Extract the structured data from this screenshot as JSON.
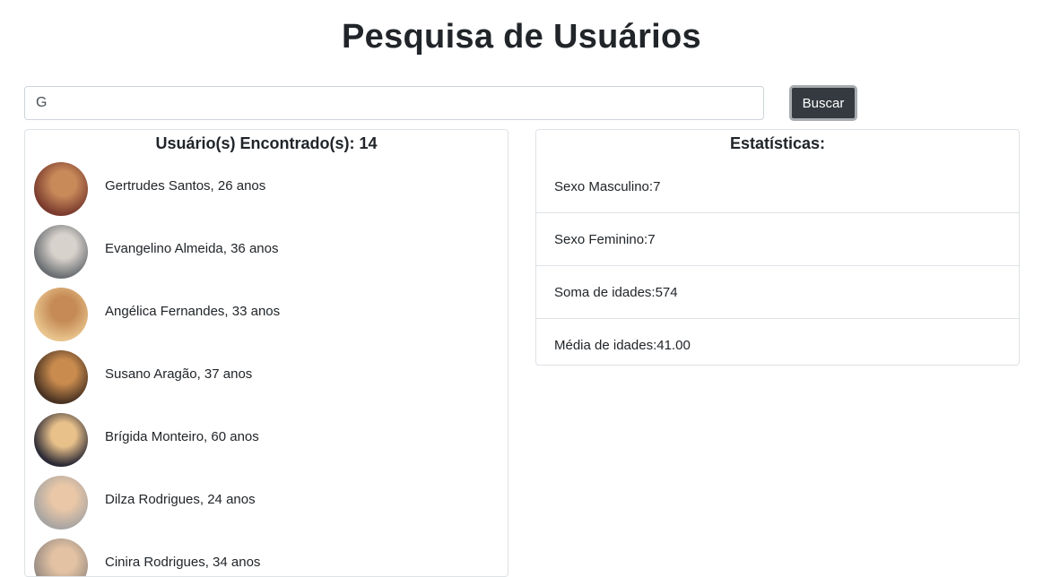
{
  "page": {
    "title": "Pesquisa de Usuários"
  },
  "search": {
    "value": "G",
    "button_label": "Buscar"
  },
  "users": {
    "header": "Usuário(s) Encontrado(s): 14",
    "items": [
      {
        "text": "Gertrudes Santos, 26 anos"
      },
      {
        "text": "Evangelino Almeida, 36 anos"
      },
      {
        "text": "Angélica Fernandes, 33 anos"
      },
      {
        "text": "Susano Aragão, 37 anos"
      },
      {
        "text": "Brígida Monteiro, 60 anos"
      },
      {
        "text": "Dilza Rodrigues, 24 anos"
      },
      {
        "text": "Cinira Rodrigues, 34 anos"
      }
    ]
  },
  "stats": {
    "header": "Estatísticas:",
    "items": [
      {
        "label": "Sexo Masculino:",
        "value": "7"
      },
      {
        "label": "Sexo Feminino:",
        "value": "7"
      },
      {
        "label": "Soma de idades:",
        "value": "574"
      },
      {
        "label": "Média de idades:",
        "value": "41.00"
      }
    ]
  },
  "avatar_colors": [
    [
      "#7a3b2e",
      "#c98a5a"
    ],
    [
      "#6b6f73",
      "#d8d2cc"
    ],
    [
      "#e8c38c",
      "#c58a55"
    ],
    [
      "#4a3322",
      "#c98b4e"
    ],
    [
      "#2c2a35",
      "#e7c08a"
    ],
    [
      "#a9a5a2",
      "#e9c7a7"
    ],
    [
      "#9a8c83",
      "#e2c2a2"
    ]
  ]
}
